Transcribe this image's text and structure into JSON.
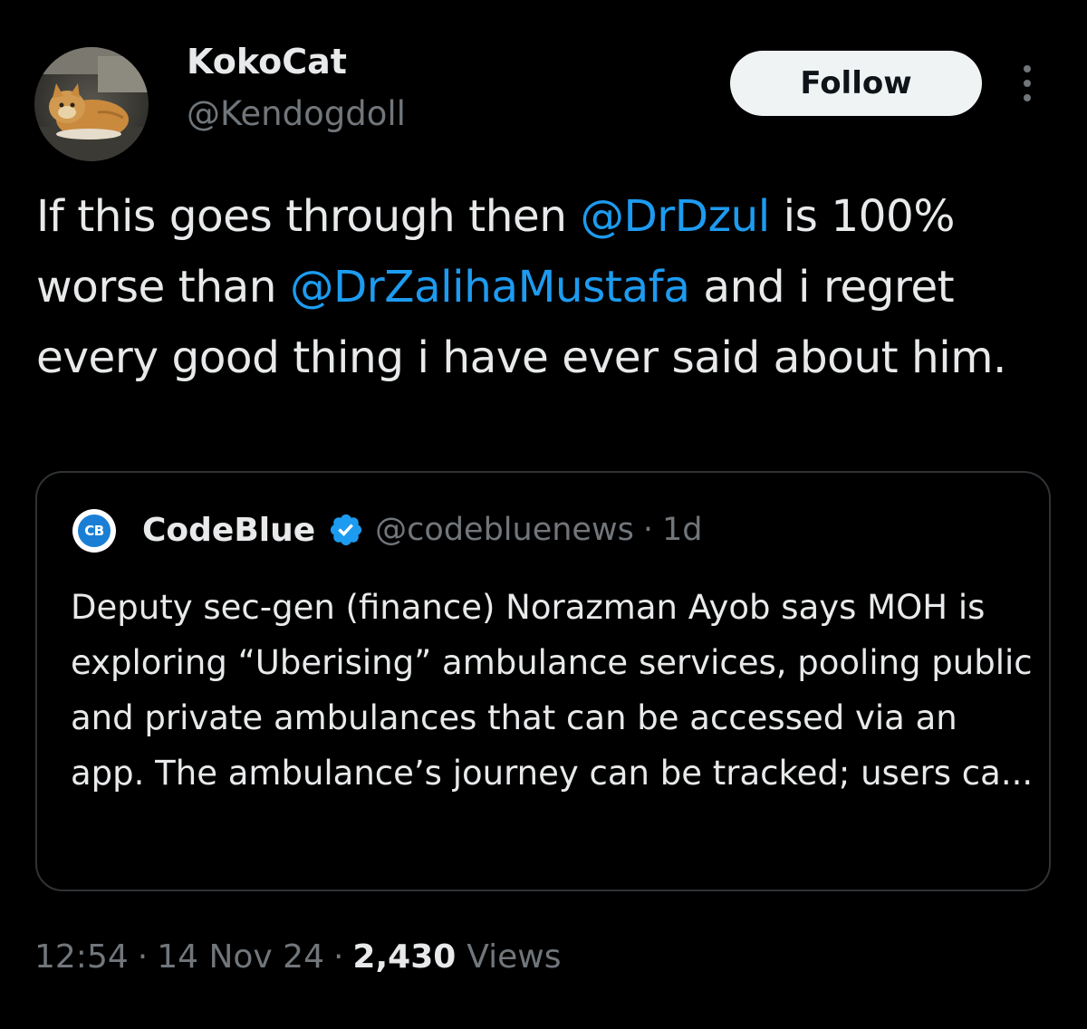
{
  "author": {
    "name": "KokoCat",
    "handle": "@Kendogdoll"
  },
  "follow_label": "Follow",
  "tweet": {
    "parts": [
      {
        "text": "If this goes through then ",
        "type": "text"
      },
      {
        "text": "@DrDzul",
        "type": "mention"
      },
      {
        "text": " is 100% worse than ",
        "type": "text"
      },
      {
        "text": "@DrZalihaMustafa",
        "type": "mention"
      },
      {
        "text": " and i regret every good thing i have ever said about him.",
        "type": "text"
      }
    ]
  },
  "quote": {
    "logo_text": "CB",
    "name": "CodeBlue",
    "handle": "@codebluenews",
    "separator": "·",
    "time": "1d",
    "text": "Deputy sec-gen (finance) Norazman Ayob says MOH is exploring “Uberising” ambulance services, pooling public and private ambulances that can be accessed via an app. The ambulance’s journey can be tracked; users ca..."
  },
  "meta": {
    "time": "12:54",
    "date": "14 Nov 24",
    "separator": "·",
    "views_count": "2,430",
    "views_label": "Views"
  },
  "colors": {
    "background": "#000000",
    "text": "#e7e9ea",
    "secondary": "#71767b",
    "accent": "#1d9bf0",
    "border": "#2f3336"
  },
  "icons": {
    "avatar": "cat-avatar",
    "more": "more-vertical-icon",
    "verified": "verified-badge-icon",
    "quote_logo": "codeblue-logo"
  }
}
